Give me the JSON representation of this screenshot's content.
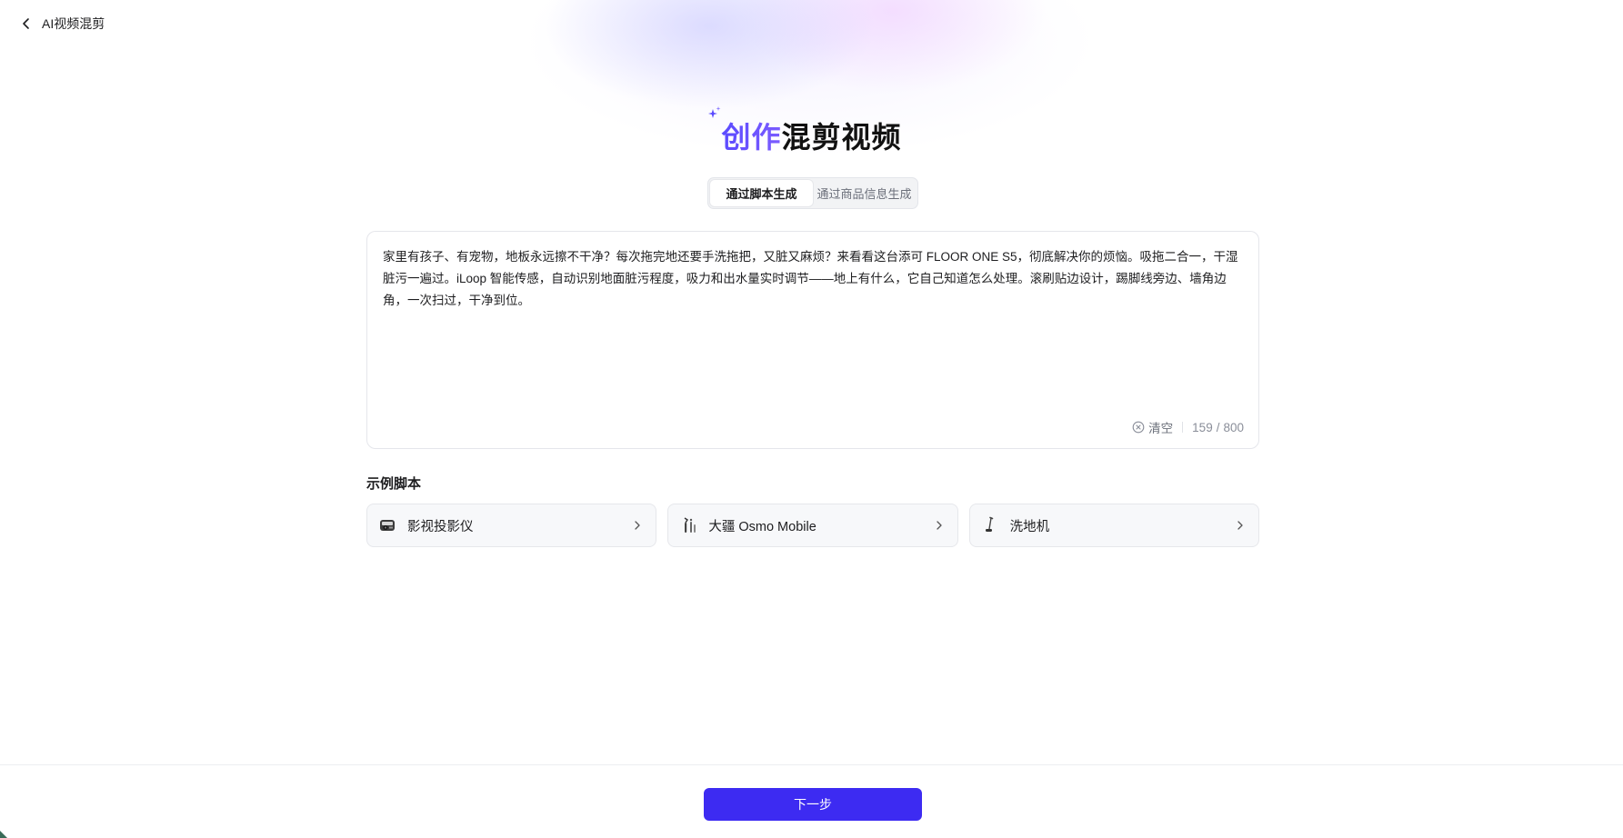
{
  "header": {
    "back_label": "AI视频混剪"
  },
  "hero": {
    "title_accent": "创作",
    "title_main": "混剪视频"
  },
  "tabs": [
    {
      "label": "通过脚本生成",
      "active": true
    },
    {
      "label": "通过商品信息生成",
      "active": false
    }
  ],
  "editor": {
    "value": "家里有孩子、有宠物，地板永远擦不干净？每次拖完地还要手洗拖把，又脏又麻烦？来看看这台添可 FLOOR ONE S5，彻底解决你的烦恼。吸拖二合一，干湿脏污一遍过。iLoop 智能传感，自动识别地面脏污程度，吸力和出水量实时调节——地上有什么，它自己知道怎么处理。滚刷贴边设计，踢脚线旁边、墙角边角，一次扫过，干净到位。",
    "clear_label": "清空",
    "count": "159",
    "count_sep": "/",
    "max": "800"
  },
  "examples": {
    "title": "示例脚本",
    "items": [
      {
        "label": "影视投影仪",
        "icon": "projector-icon"
      },
      {
        "label": "大疆 Osmo Mobile",
        "icon": "gimbal-icon"
      },
      {
        "label": "洗地机",
        "icon": "floor-washer-icon"
      }
    ]
  },
  "footer": {
    "next_label": "下一步"
  },
  "colors": {
    "accent": "#3d2bf2",
    "title_gradient_start": "#5b4bff",
    "title_gradient_end": "#7b5cff"
  }
}
